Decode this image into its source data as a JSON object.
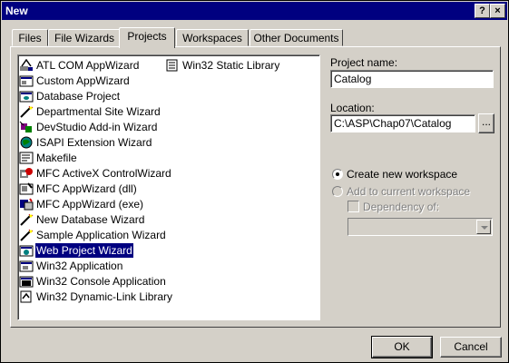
{
  "window": {
    "title": "New",
    "help_label": "?",
    "close_label": "×"
  },
  "tabs": [
    {
      "label": "Files"
    },
    {
      "label": "File Wizards"
    },
    {
      "label": "Projects",
      "active": true
    },
    {
      "label": "Workspaces"
    },
    {
      "label": "Other Documents"
    }
  ],
  "projects": {
    "items": [
      {
        "label": "ATL COM AppWizard",
        "icon": "atl-wizard-icon"
      },
      {
        "label": "Custom AppWizard",
        "icon": "custom-wizard-icon"
      },
      {
        "label": "Database Project",
        "icon": "database-icon"
      },
      {
        "label": "Departmental Site Wizard",
        "icon": "wizard-wand-icon"
      },
      {
        "label": "DevStudio Add-in Wizard",
        "icon": "addin-icon"
      },
      {
        "label": "ISAPI Extension Wizard",
        "icon": "globe-icon"
      },
      {
        "label": "Makefile",
        "icon": "makefile-icon"
      },
      {
        "label": "MFC ActiveX ControlWizard",
        "icon": "activex-icon"
      },
      {
        "label": "MFC AppWizard (dll)",
        "icon": "mfc-dll-icon"
      },
      {
        "label": "MFC AppWizard (exe)",
        "icon": "mfc-exe-icon"
      },
      {
        "label": "New Database Wizard",
        "icon": "wizard-wand-icon"
      },
      {
        "label": "Sample Application Wizard",
        "icon": "wizard-wand-icon"
      },
      {
        "label": "Web Project Wizard",
        "icon": "web-project-icon",
        "selected": true
      },
      {
        "label": "Win32 Application",
        "icon": "win32-app-icon"
      },
      {
        "label": "Win32 Console Application",
        "icon": "console-icon"
      },
      {
        "label": "Win32 Dynamic-Link Library",
        "icon": "dll-icon"
      },
      {
        "label": "Win32 Static Library",
        "icon": "static-lib-icon"
      }
    ]
  },
  "form": {
    "project_name_label": "Project name:",
    "project_name_value": "Catalog",
    "location_label": "Location:",
    "location_value": "C:\\ASP\\Chap07\\Catalog",
    "browse_label": "...",
    "create_workspace_label": "Create new workspace",
    "add_workspace_label": "Add to current workspace",
    "dependency_label": "Dependency of:",
    "dependency_value": ""
  },
  "buttons": {
    "ok_label": "OK",
    "cancel_label": "Cancel"
  },
  "colors": {
    "titlebar": "#000080",
    "selection": "#000080",
    "face": "#d4d0c8"
  }
}
